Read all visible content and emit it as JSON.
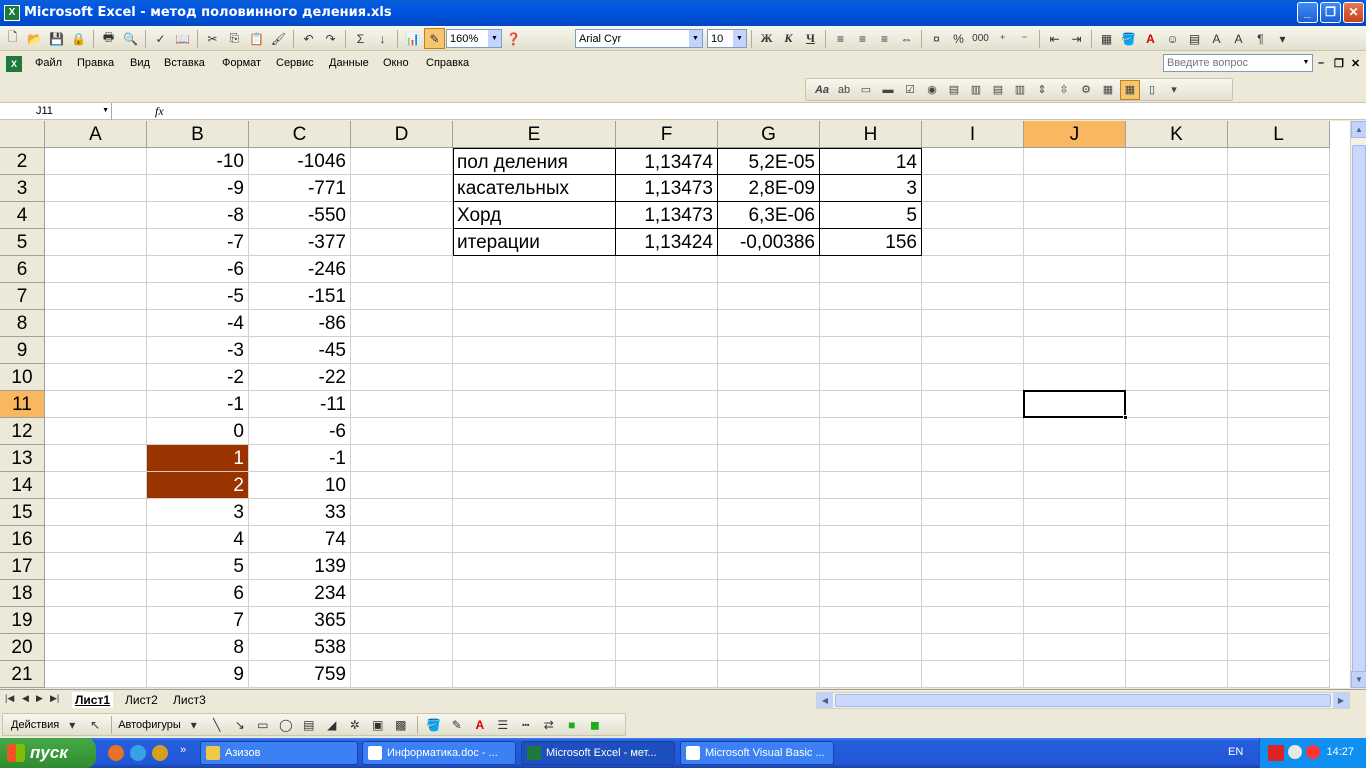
{
  "window": {
    "title": "Microsoft Excel - метод половинного деления.xls",
    "app_icon": "X"
  },
  "toolbar": {
    "zoom": "160%",
    "font": "Arial Cyr",
    "size": "10",
    "bold": "Ж",
    "italic": "К",
    "underline": "Ч",
    "percent": "%",
    "thousands": "000",
    "sum": "Σ"
  },
  "menu": [
    "Файл",
    "Правка",
    "Вид",
    "Вставка",
    "Формат",
    "Сервис",
    "Данные",
    "Окно",
    "Справка"
  ],
  "question_placeholder": "Введите вопрос",
  "formula": {
    "namebox": "J11",
    "fx": "fx",
    "content": ""
  },
  "columns": [
    "A",
    "B",
    "C",
    "D",
    "E",
    "F",
    "G",
    "H",
    "I",
    "J",
    "K",
    "L"
  ],
  "rows": [
    {
      "n": "2",
      "B": "-10",
      "C": "-1046",
      "E": "пол деления",
      "F": "1,13474",
      "G": "5,2E-05",
      "H": "14"
    },
    {
      "n": "3",
      "B": "-9",
      "C": "-771",
      "E": "касательных",
      "F": "1,13473",
      "G": "2,8E-09",
      "H": "3"
    },
    {
      "n": "4",
      "B": "-8",
      "C": "-550",
      "E": "Хорд",
      "F": "1,13473",
      "G": "6,3E-06",
      "H": "5"
    },
    {
      "n": "5",
      "B": "-7",
      "C": "-377",
      "E": "итерации",
      "F": "1,13424",
      "G": "-0,00386",
      "H": "156"
    },
    {
      "n": "6",
      "B": "-6",
      "C": "-246"
    },
    {
      "n": "7",
      "B": "-5",
      "C": "-151"
    },
    {
      "n": "8",
      "B": "-4",
      "C": "-86"
    },
    {
      "n": "9",
      "B": "-3",
      "C": "-45"
    },
    {
      "n": "10",
      "B": "-2",
      "C": "-22"
    },
    {
      "n": "11",
      "B": "-1",
      "C": "-11"
    },
    {
      "n": "12",
      "B": "0",
      "C": "-6"
    },
    {
      "n": "13",
      "B": "1",
      "C": "-1"
    },
    {
      "n": "14",
      "B": "2",
      "C": "10"
    },
    {
      "n": "15",
      "B": "3",
      "C": "33"
    },
    {
      "n": "16",
      "B": "4",
      "C": "74"
    },
    {
      "n": "17",
      "B": "5",
      "C": "139"
    },
    {
      "n": "18",
      "B": "6",
      "C": "234"
    },
    {
      "n": "19",
      "B": "7",
      "C": "365"
    },
    {
      "n": "20",
      "B": "8",
      "C": "538"
    },
    {
      "n": "21",
      "B": "9",
      "C": "759"
    }
  ],
  "selected": {
    "column": "J",
    "row": "11"
  },
  "sheets": [
    "Лист1",
    "Лист2",
    "Лист3"
  ],
  "drawing": {
    "actions": "Действия",
    "autoshapes": "Автофигуры"
  },
  "taskbar": {
    "start": "пуск",
    "tasks": [
      "Азизов",
      "Информатика.doc - ...",
      "Microsoft Excel - мет...",
      "Microsoft Visual Basic ..."
    ],
    "lang": "EN",
    "clock": "14:27"
  },
  "colors": {
    "fill": "#993300",
    "selected_header": "#f9b860"
  }
}
